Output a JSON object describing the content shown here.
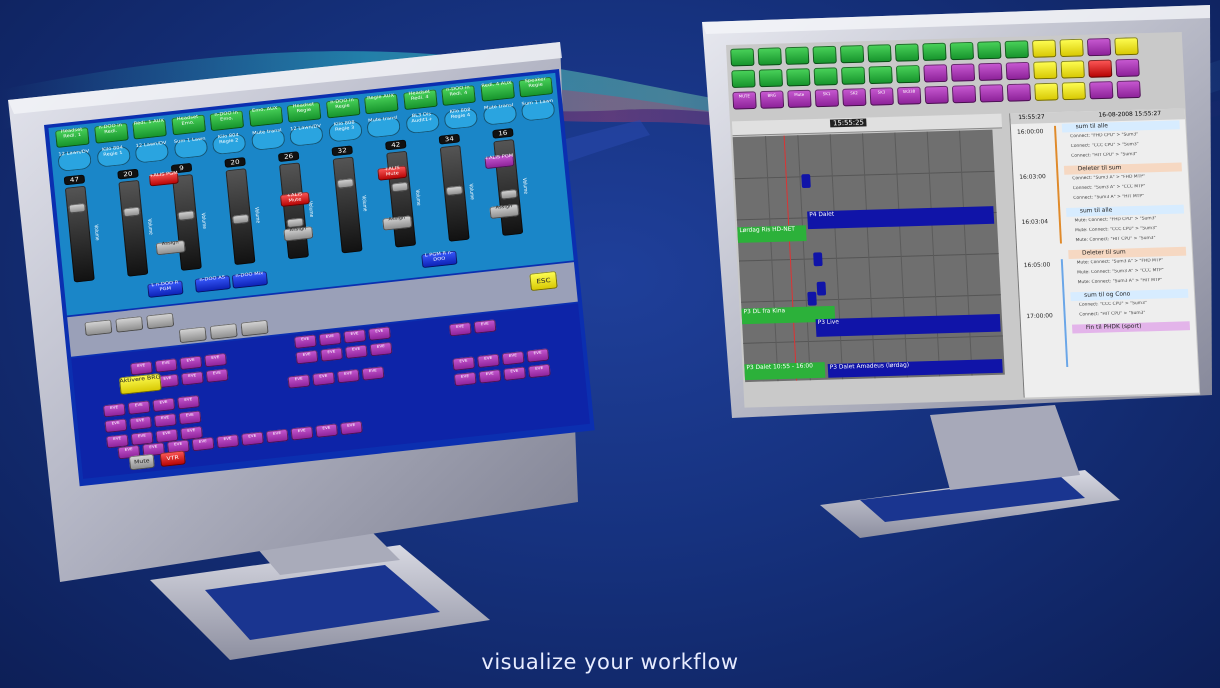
{
  "tagline": "visualize your workflow",
  "colors": {
    "background": "#16327f",
    "monitor_frame": "#b8bac7",
    "left_screen_bg": "#0b2fb0",
    "green_button": "#2bb33f",
    "purple_button": "#a63bb3",
    "right_screen_bg": "#c9c9c9",
    "timeline_block": "#1014a8"
  },
  "left_monitor": {
    "top_buttons": [
      "Headset Redi. 1",
      "n-DOO in Redi.",
      "Redi. 1 AUX",
      "Headset Emo.",
      "n-DOO in Emo.",
      "Emo. AUX",
      "Headset Regie",
      "n-DOO in Regie",
      "Regie AUX",
      "Headset Redi. 4",
      "n-DOO in Redi. 4",
      "Redi. 4 AUX",
      "Speaker Regie"
    ],
    "channel_labels": [
      "12 Lawn/DV",
      "Kilo 804 Regie 1",
      "12 Lawn/DV",
      "Sum 1 Lawn",
      "Kilo 804 Regie 2",
      "Mute transl",
      "12 Lawn/DV",
      "Kilo 808 Regie 3",
      "Mute transl",
      "BL3 Dis Audit1+",
      "Kilo 808 Regie 4",
      "Mute transl",
      "Sum 1 Lawn"
    ],
    "channel_levels": [
      "47",
      "20",
      "9",
      "20",
      "26",
      "32",
      "42",
      "34",
      "16"
    ],
    "fader_label": "Volume",
    "status_buttons": [
      "+ALIS PGM",
      "+ALIS Mute",
      "+ALIS Mute",
      "+ALIS PGM"
    ],
    "side_buttons": [
      "Assign",
      "Assign",
      "Assign",
      "Assign"
    ],
    "bottom_row": [
      "n-DOO Mix",
      "L n-DOO R PGM",
      "n-DOO AS",
      "L PGM R n-DOO"
    ],
    "esc_button": "ESC",
    "action_button": "Aktivere BRG",
    "grid_label": "EVE",
    "bottom_buttons": [
      "Mute",
      "VTR"
    ]
  },
  "right_monitor": {
    "clock": "15:55:25",
    "panel_time": "15:55:27",
    "panel_date": "16-08-2008 15:55:27",
    "time_rows": [
      "16:00:00",
      "16:03:00",
      "16:03:04",
      "16:05:00",
      "17:00:00"
    ],
    "event_groups": [
      {
        "title": "sum til alle",
        "items": [
          "Connect: \"FHD CPU\" > \"Sum3\"",
          "Connect: \"CCC CPU\" > \"Sum3\"",
          "Connect: \"HIT CPU\" > \"Sum3\""
        ]
      },
      {
        "title": "Deleter til sum",
        "items": [
          "Connect: \"Sum3 A\" > \"FHD MTP\"",
          "Connect: \"Sum3 A\" > \"CCC MTP\"",
          "Connect: \"Sum3 A\" > \"HIT MTP\""
        ]
      },
      {
        "title": "sum til alle",
        "items": [
          "Mute: Connect: \"FHD CPU\" > \"Sum3\"",
          "Mute: Connect: \"CCC CPU\" > \"Sum3\"",
          "Mute: Connect: \"HIT CPU\" > \"Sum3\""
        ]
      },
      {
        "title": "Deleter til sum",
        "items": [
          "Mute: Connect: \"Sum3 A\" > \"FHD MTP\"",
          "Mute: Connect: \"Sum3 A\" > \"CCC MTP\"",
          "Mute: Connect: \"Sum3 A\" > \"HIT MTP\""
        ]
      },
      {
        "title": "sum til og Cono",
        "items": [
          "Connect: \"CCC CPU\" > \"Sum3\"",
          "Connect: \"HIT CPU\" > \"Sum3\""
        ]
      },
      {
        "title": "Fin til PHDK (sport)",
        "items": []
      }
    ],
    "timeline_blocks": [
      "Lørdag Ris HD-NET",
      "P4 Dalet",
      "P3 DL fra Kina",
      "P3 Live",
      "P3 Dalet 10:55 - 16:00",
      "P3 Dalet Amadeus (lørdag)"
    ],
    "top_buttons": [
      "MUTE",
      "BRG",
      "Mute",
      "SK1",
      "SK2",
      "SK3",
      "SK338"
    ]
  }
}
